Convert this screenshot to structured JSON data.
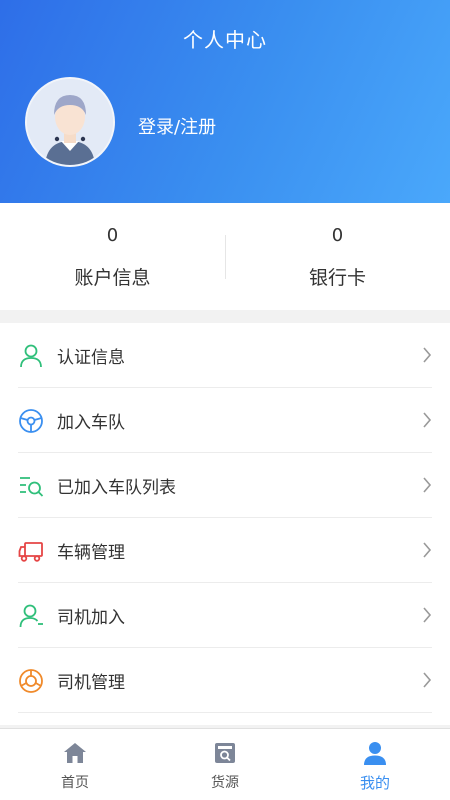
{
  "header": {
    "title": "个人中心",
    "login_label": "登录/注册"
  },
  "stats": [
    {
      "value": "0",
      "label": "账户信息"
    },
    {
      "value": "0",
      "label": "银行卡"
    }
  ],
  "menu": [
    {
      "label": "认证信息",
      "icon": "user-verify-icon",
      "color": "#2fbf7a"
    },
    {
      "label": "加入车队",
      "icon": "steering-wheel-icon",
      "color": "#3a8ff0"
    },
    {
      "label": "已加入车队列表",
      "icon": "list-search-icon",
      "color": "#2fbf7a"
    },
    {
      "label": "车辆管理",
      "icon": "truck-icon",
      "color": "#e54545"
    },
    {
      "label": "司机加入",
      "icon": "driver-add-icon",
      "color": "#2fbf7a"
    },
    {
      "label": "司机管理",
      "icon": "driver-manage-icon",
      "color": "#f08a2b"
    }
  ],
  "tabs": [
    {
      "label": "首页",
      "icon": "home-icon",
      "active": false
    },
    {
      "label": "货源",
      "icon": "cargo-icon",
      "active": false
    },
    {
      "label": "我的",
      "icon": "profile-icon",
      "active": true
    }
  ],
  "colors": {
    "accent": "#3a8ff0",
    "header_start": "#2e6ee8",
    "header_end": "#4aa8fb"
  }
}
